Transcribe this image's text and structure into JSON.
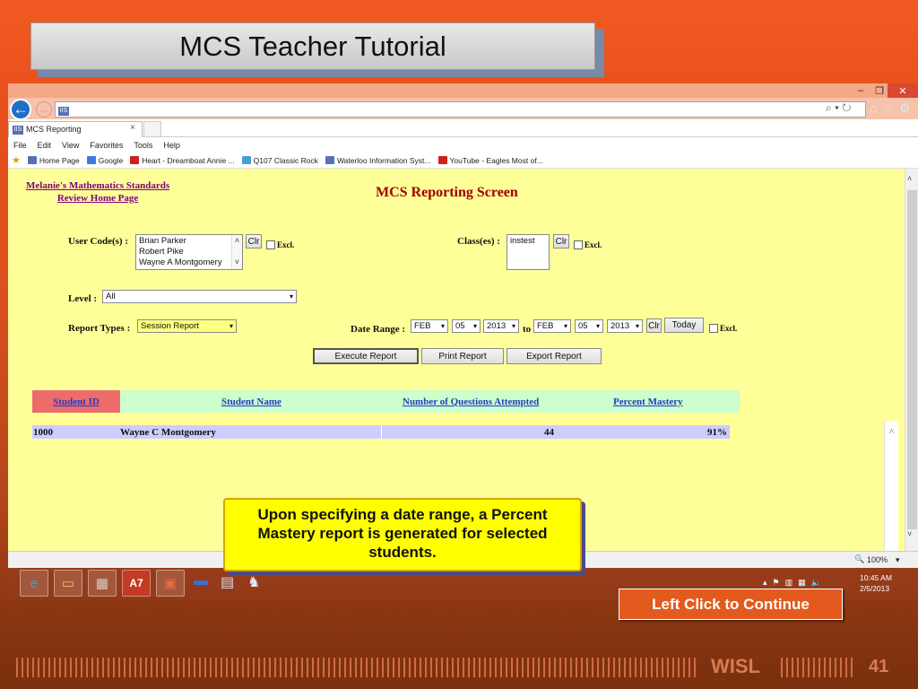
{
  "slide": {
    "title": "MCS Teacher Tutorial",
    "callout": "Upon specifying a date range, a Percent Mastery report is generated for selected students.",
    "continue_label": "Left Click to Continue",
    "footer_brand": "WISL",
    "page_number": "41"
  },
  "browser": {
    "window_controls": [
      "–",
      "❐",
      "✕"
    ],
    "address_value": "",
    "address_tools": "⌕ ▾ ↻",
    "tab_label": "MCS Reporting",
    "tab_close": "×",
    "menu": [
      "File",
      "Edit",
      "View",
      "Favorites",
      "Tools",
      "Help"
    ],
    "favorites": [
      {
        "label": "Home Page",
        "color": "#5b6fb4"
      },
      {
        "label": "Google",
        "color": "#3b7be0"
      },
      {
        "label": "Heart - Dreamboat Annie ...",
        "color": "#d0201a"
      },
      {
        "label": "Q107 Classic Rock",
        "color": "#4b9cd6"
      },
      {
        "label": "Waterloo Information Syst...",
        "color": "#5b6fb4"
      },
      {
        "label": "YouTube - Eagles Most of...",
        "color": "#d0201a"
      }
    ],
    "zoom": "100%",
    "zoom_icon": "🔍"
  },
  "page": {
    "home_link_line1": "Melanie's Mathematics Standards",
    "home_link_line2": "Review Home Page",
    "title": "MCS Reporting Screen",
    "user_codes_label": "User Code(s) :",
    "user_codes": [
      "Brian Parker",
      "Robert Pike",
      "Wayne A Montgomery"
    ],
    "classes_label": "Class(es) :",
    "classes": [
      "instest"
    ],
    "clr_label": "Clr",
    "excl_label": "Excl.",
    "level_label": "Level :",
    "level_value": "All",
    "report_types_label": "Report Types :",
    "report_type_value": "Session Report",
    "date_range_label": "Date Range :",
    "date_from": {
      "month": "FEB",
      "day": "05",
      "year": "2013"
    },
    "to_label": "to",
    "date_to": {
      "month": "FEB",
      "day": "05",
      "year": "2013"
    },
    "today_label": "Today",
    "execute_label": "Execute Report",
    "print_label": "Print Report",
    "export_label": "Export Report",
    "table": {
      "headers": [
        "Student ID",
        "Student Name",
        "Number of Questions Attempted",
        "Percent Mastery"
      ],
      "rows": [
        {
          "id": "1000",
          "name": "Wayne C Montgomery",
          "attempted": "44",
          "mastery": "91%"
        }
      ]
    }
  },
  "taskbar": {
    "time": "10:45 AM",
    "date": "2/5/2013"
  },
  "colors": {
    "slide_orange": "#f15a22",
    "page_bg": "#ffff99",
    "header_row": "#ccffcc",
    "student_id_header": "#ee6b6b",
    "data_row": "#ccccff",
    "callout_bg": "#ffff00",
    "continue_bg": "#e35a1e"
  }
}
